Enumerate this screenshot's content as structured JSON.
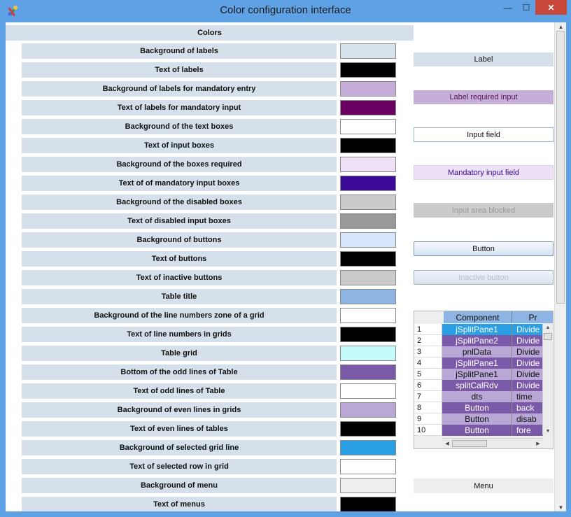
{
  "window": {
    "title": "Color configuration interface",
    "minimize_label": "—",
    "maximize_label": "☐",
    "close_label": "✕"
  },
  "colors_header": "Colors",
  "rows": [
    {
      "label": "Background of labels",
      "color": "#d7e2ec"
    },
    {
      "label": "Text of labels",
      "color": "#000000"
    },
    {
      "label": "Background of labels for mandatory entry",
      "color": "#c5aed8"
    },
    {
      "label": "Text of labels for mandatory input",
      "color": "#6a0062"
    },
    {
      "label": "Background of the text boxes",
      "color": "#ffffff"
    },
    {
      "label": "Text of input boxes",
      "color": "#000000"
    },
    {
      "label": "Background of the boxes required",
      "color": "#efe1f7"
    },
    {
      "label": "Text of of mandatory input boxes",
      "color": "#3b0a96"
    },
    {
      "label": "Background of the disabled boxes",
      "color": "#cbcbcb"
    },
    {
      "label": "Text of disabled input boxes",
      "color": "#999999"
    },
    {
      "label": "Background of buttons",
      "color": "#d6e7fc"
    },
    {
      "label": "Text of buttons",
      "color": "#000000"
    },
    {
      "label": "Text of inactive buttons",
      "color": "#cbcbcb"
    },
    {
      "label": "Table title",
      "color": "#8db4e2"
    },
    {
      "label": "Background of the line numbers zone of a grid",
      "color": "#ffffff"
    },
    {
      "label": "Text of line numbers in grids",
      "color": "#000000"
    },
    {
      "label": "Table grid",
      "color": "#c5fbfc"
    },
    {
      "label": "Bottom of the odd lines of Table",
      "color": "#7a5aa8"
    },
    {
      "label": "Text of odd lines of Table",
      "color": "#ffffff"
    },
    {
      "label": "Background of even lines in grids",
      "color": "#b9a8d6"
    },
    {
      "label": "Text of even lines of tables",
      "color": "#000000"
    },
    {
      "label": "Background of selected grid line",
      "color": "#2a9fe3"
    },
    {
      "label": "Text of selected row in grid",
      "color": "#ffffff"
    },
    {
      "label": "Background of menu",
      "color": "#eeeeee"
    },
    {
      "label": "Text of menus",
      "color": "#000000"
    }
  ],
  "preview": {
    "label": "Label",
    "label_required": "Label required input",
    "input_field": "Input field",
    "mandatory_input": "Mandatory input field",
    "input_blocked": "Input area blocked",
    "button": "Button",
    "inactive_button": "Inactive button",
    "menu": "Menu"
  },
  "grid": {
    "columns": [
      "Component",
      "Pr"
    ],
    "rows": [
      {
        "num": "1",
        "c1": "jSplitPane1",
        "c2": "Divide",
        "kind": "sel"
      },
      {
        "num": "2",
        "c1": "jSplitPane2",
        "c2": "Divide",
        "kind": "odd"
      },
      {
        "num": "3",
        "c1": "pnlData",
        "c2": "Divide",
        "kind": "even"
      },
      {
        "num": "4",
        "c1": "jSplitPane1",
        "c2": "Divide",
        "kind": "odd"
      },
      {
        "num": "5",
        "c1": "jSplitPane1",
        "c2": "Divide",
        "kind": "even"
      },
      {
        "num": "6",
        "c1": "splitCalRdv",
        "c2": "Divide",
        "kind": "odd"
      },
      {
        "num": "7",
        "c1": "dts",
        "c2": "time",
        "kind": "even"
      },
      {
        "num": "8",
        "c1": "Button",
        "c2": "back",
        "kind": "odd"
      },
      {
        "num": "9",
        "c1": "Button",
        "c2": "disab",
        "kind": "even"
      },
      {
        "num": "10",
        "c1": "Button",
        "c2": "fore",
        "kind": "odd"
      }
    ]
  }
}
